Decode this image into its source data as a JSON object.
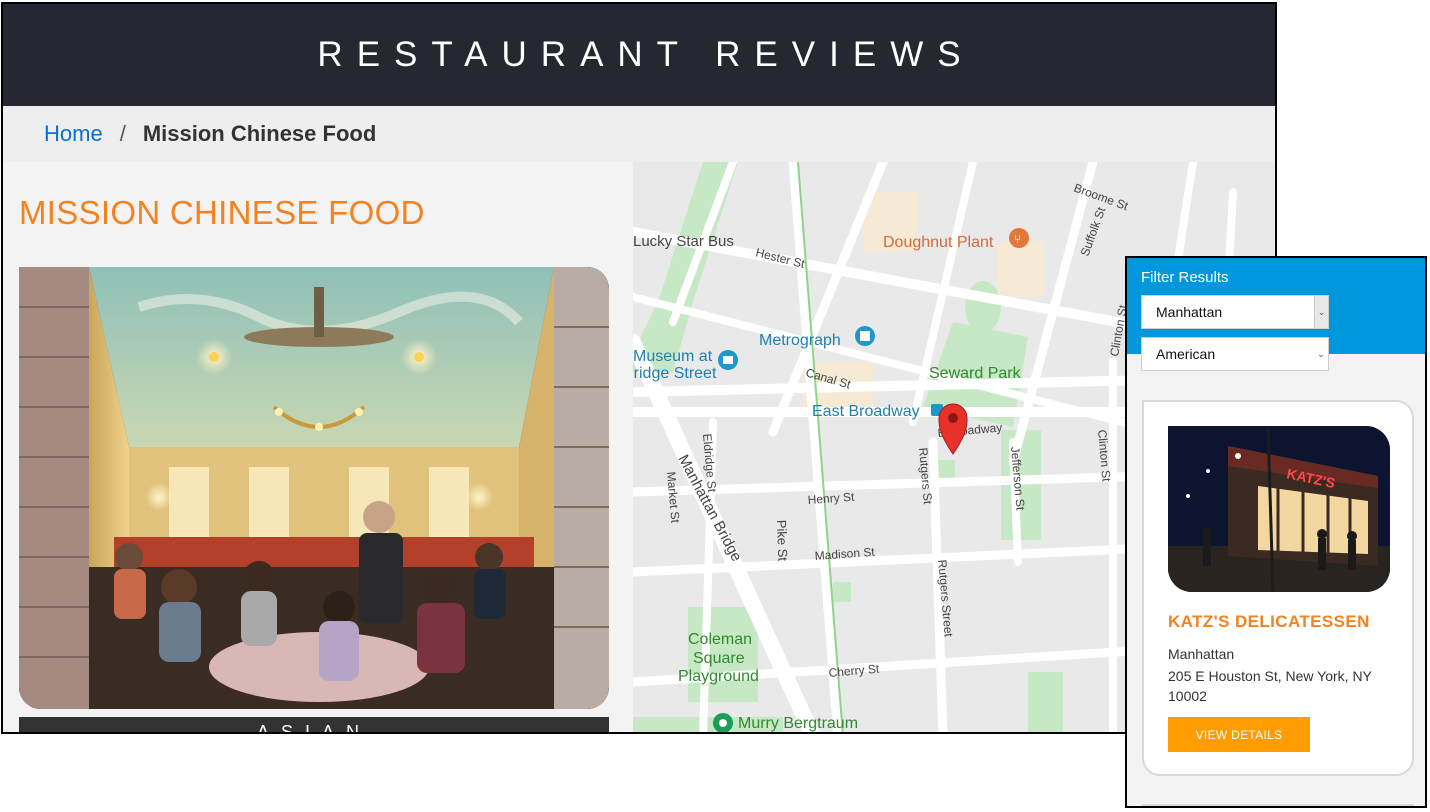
{
  "site": {
    "title": "RESTAURANT REVIEWS"
  },
  "breadcrumb": {
    "home": "Home",
    "separator": "/",
    "current": "Mission Chinese Food"
  },
  "restaurant": {
    "name": "MISSION CHINESE FOOD",
    "cuisine": "ASIAN",
    "photo_icon": "restaurant-dining-room-photo"
  },
  "map": {
    "labels": {
      "lucky_star": "Lucky Star Bus",
      "hester": "Hester St",
      "doughnut": "Doughnut Plant",
      "broome": "Broome St",
      "suffolk": "Suffolk St",
      "clinton_n": "Clinton St",
      "metrograph": "Metrograph",
      "museum1": "Museum at",
      "museum2": "Bridge Street",
      "canal": "Canal St",
      "seward": "Seward Park",
      "east_broadway": "East Broadway",
      "e_broadway_st": "E Broadway",
      "eldridge": "Eldridge St",
      "manhattan_bridge": "Manhattan Bridge",
      "market": "Market St",
      "henry": "Henry St",
      "rutgers1": "Rutgers St",
      "jefferson": "Jefferson St",
      "clinton_s": "Clinton St",
      "pike": "Pike St",
      "madison": "Madison St",
      "rutgers2": "Rutgers Street",
      "coleman1": "Coleman",
      "coleman2": "Square",
      "coleman3": "Playground",
      "cherry": "Cherry St",
      "murry": "Murry Bergtraum"
    },
    "marker_icon": "map-pin-icon",
    "colors": {
      "park": "#c7e8c5",
      "road": "#ffffff",
      "block": "#e9e9e9",
      "poi_orange": "#e07a3c",
      "poi_blue": "#1e97c9",
      "pin": "#e8312a"
    }
  },
  "filter": {
    "title": "Filter Results",
    "neighborhood": {
      "selected": "Manhattan"
    },
    "cuisine": {
      "selected": "American"
    }
  },
  "card": {
    "name": "KATZ'S DELICATESSEN",
    "neighborhood": "Manhattan",
    "address": "205 E Houston St, New York, NY 10002",
    "button": "VIEW DETAILS",
    "photo_icon": "storefront-night-photo"
  },
  "colors": {
    "header": "#252831",
    "accent": "#f58220",
    "link": "#0b6ed1",
    "filter_bg": "#0097dc",
    "button": "#ff9d00",
    "cuisine_bar": "#333333"
  }
}
